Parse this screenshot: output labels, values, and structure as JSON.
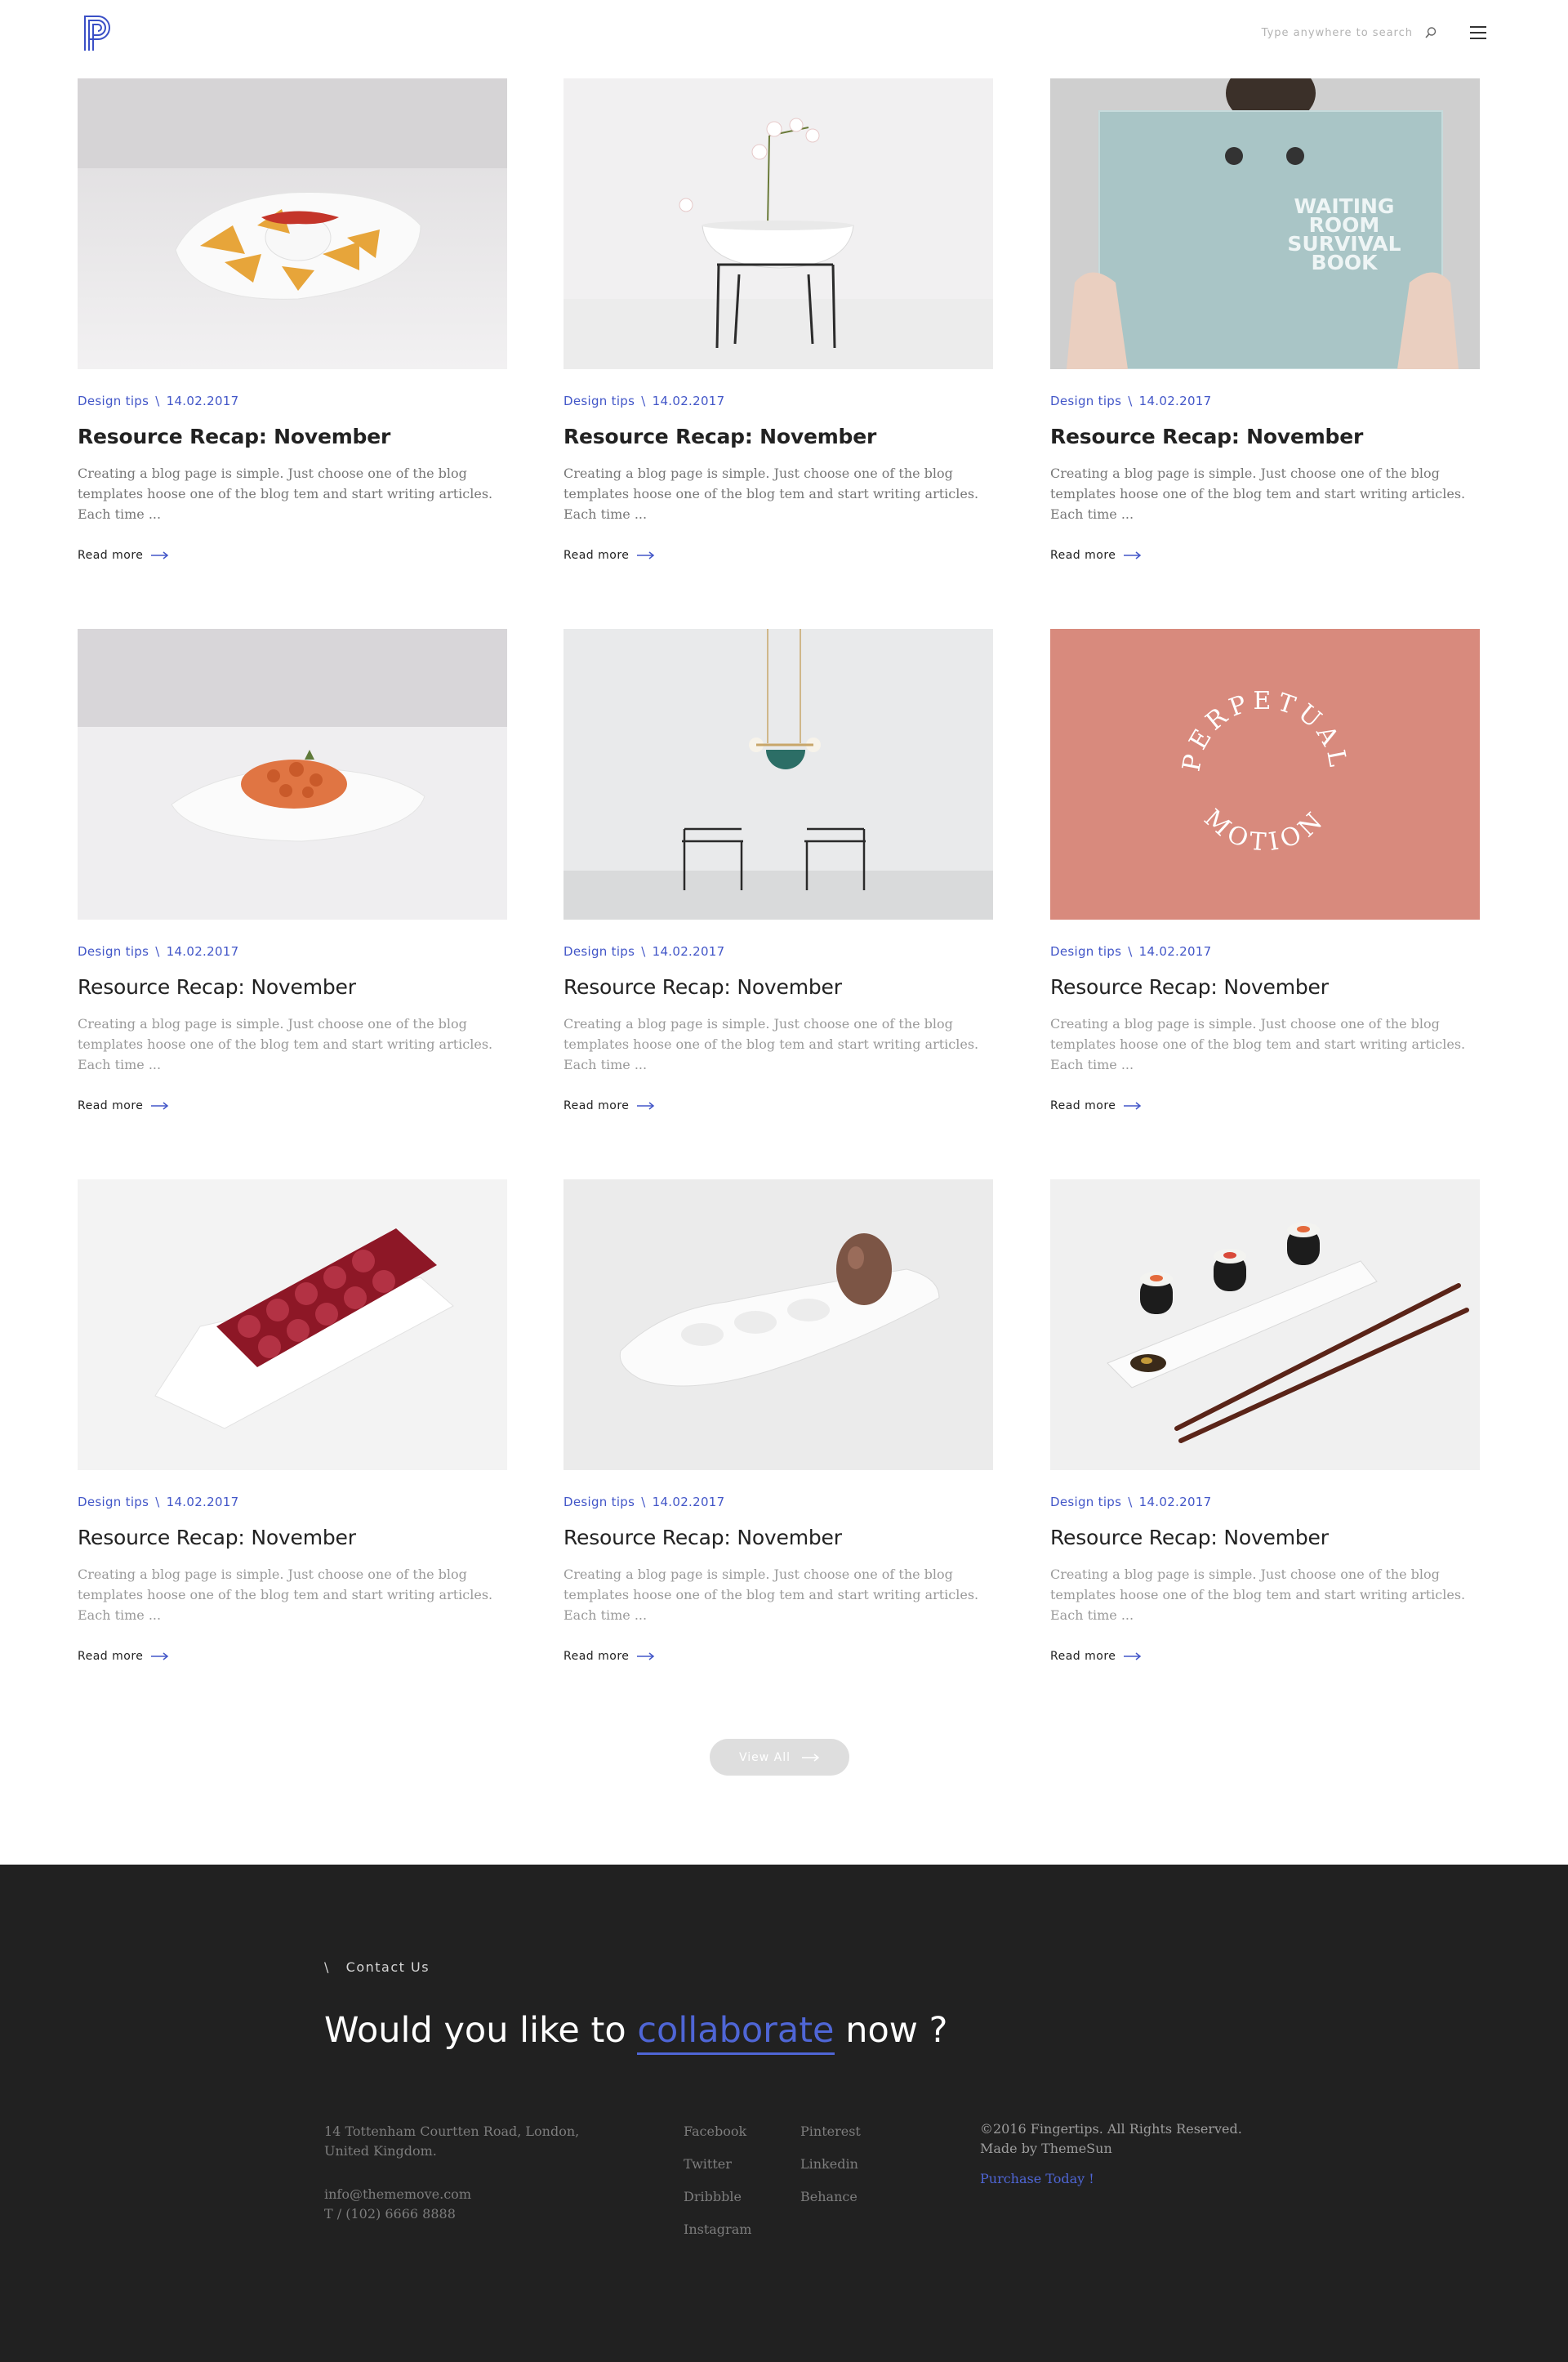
{
  "header": {
    "search_placeholder": "Type anywhere to search"
  },
  "posts": [
    {
      "category": "Design tips",
      "separator": "\\",
      "date": "14.02.2017",
      "title": "Resource Recap: November",
      "excerpt": "Creating a blog page is simple. Just choose one of the blog templates hoose one of the blog tem and start writing articles. Each time ...",
      "read_more": "Read more",
      "image": "nachos-dish-photo"
    },
    {
      "category": "Design tips",
      "separator": "\\",
      "date": "14.02.2017",
      "title": "Resource Recap: November",
      "excerpt": "Creating a blog page is simple. Just choose one of the blog templates hoose one of the blog tem and start writing articles. Each time ...",
      "read_more": "Read more",
      "image": "orchid-planter-photo"
    },
    {
      "category": "Design tips",
      "separator": "\\",
      "date": "14.02.2017",
      "title": "Resource Recap: November",
      "excerpt": "Creating a blog page is simple. Just choose one of the blog templates hoose one of the blog tem and start writing articles. Each time ...",
      "read_more": "Read more",
      "image": "book-reader-photo",
      "image_text": "WAITING ROOM SURVIVAL BOOK"
    },
    {
      "category": "Design tips",
      "separator": "\\",
      "date": "14.02.2017",
      "title": "Resource Recap: November",
      "excerpt": "Creating a blog page is simple. Just choose one of the blog templates hoose one of the blog tem and start writing articles. Each time ...",
      "read_more": "Read more",
      "image": "pasta-dish-photo"
    },
    {
      "category": "Design tips",
      "separator": "\\",
      "date": "14.02.2017",
      "title": "Resource Recap: November",
      "excerpt": "Creating a blog page is simple. Just choose one of the blog templates hoose one of the blog tem and start writing articles. Each time ...",
      "read_more": "Read more",
      "image": "pendant-lamp-chairs-photo"
    },
    {
      "category": "Design tips",
      "separator": "\\",
      "date": "14.02.2017",
      "title": "Resource Recap: November",
      "excerpt": "Creating a blog page is simple. Just choose one of the blog templates hoose one of the blog tem and start writing articles. Each time ...",
      "read_more": "Read more",
      "image": "perpetual-motion-cover",
      "image_text": "PERPETUAL MOTION"
    },
    {
      "category": "Design tips",
      "separator": "\\",
      "date": "14.02.2017",
      "title": "Resource Recap: November",
      "excerpt": "Creating a blog page is simple. Just choose one of the blog templates hoose one of the blog tem and start writing articles. Each time ...",
      "read_more": "Read more",
      "image": "red-egg-tray-photo"
    },
    {
      "category": "Design tips",
      "separator": "\\",
      "date": "14.02.2017",
      "title": "Resource Recap: November",
      "excerpt": "Creating a blog page is simple. Just choose one of the blog templates hoose one of the blog tem and start writing articles. Each time ...",
      "read_more": "Read more",
      "image": "egg-holder-photo"
    },
    {
      "category": "Design tips",
      "separator": "\\",
      "date": "14.02.2017",
      "title": "Resource Recap: November",
      "excerpt": "Creating a blog page is simple. Just choose one of the blog templates hoose one of the blog tem and start writing articles. Each time ...",
      "read_more": "Read more",
      "image": "sushi-tray-photo"
    }
  ],
  "view_all_label": "View All",
  "footer": {
    "contact_label": "\\   Contact Us",
    "headline_before": "Would you like to",
    "headline_link": "collaborate",
    "headline_after": "now ?",
    "address": "14 Tottenham Courtten Road, London, United Kingdom.",
    "email": "info@thememove.com",
    "phone": "T / (102) 6666 8888",
    "social_left": [
      "Facebook",
      "Twitter",
      "Dribbble",
      "Instagram"
    ],
    "social_right": [
      "Pinterest",
      "Linkedin",
      "Behance"
    ],
    "copyright": "©2016 Fingertips. All Rights Reserved.",
    "made_by": "Made by ThemeSun",
    "purchase": "Purchase Today !"
  },
  "colors": {
    "accent": "#4256c8",
    "footer_bg": "#212121"
  }
}
